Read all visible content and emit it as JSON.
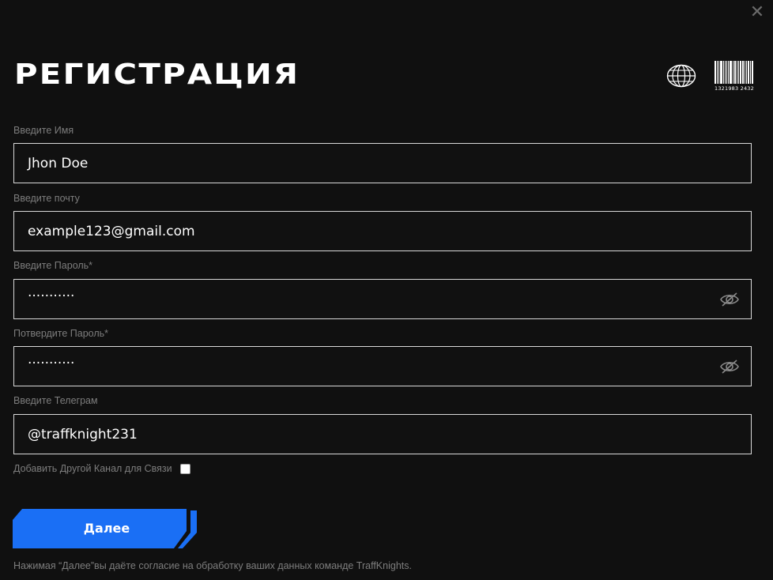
{
  "dialog": {
    "close_glyph": "✕",
    "title": "РЕГИСТРАЦИЯ",
    "barcode_number": "1321983 2432"
  },
  "form": {
    "name": {
      "label": "Введите Имя",
      "value": "Jhon Doe"
    },
    "email": {
      "label": "Введите почту",
      "value": "example123@gmail.com"
    },
    "password": {
      "label": "Введите Пароль*",
      "masked_value": "···········"
    },
    "password_confirm": {
      "label": "Потвердите Пароль*",
      "masked_value": "···········"
    },
    "telegram": {
      "label": "Введите Телеграм",
      "value": "@traffknight231"
    },
    "extra_channel": {
      "label": "Добавить Другой Канал для Связи",
      "checked": false
    }
  },
  "actions": {
    "next_label": "Далее"
  },
  "consent_text": "Нажимая “Далее”вы даёте согласие на обработку ваших данных команде TraffKnights.",
  "icons": {
    "close": "close-icon",
    "globe": "globe-icon",
    "barcode": "barcode-icon",
    "eye": "eye-off-icon"
  },
  "colors": {
    "background": "#101010",
    "accent": "#1a6ff5",
    "field_border": "#d9d9d9",
    "label": "#7d7d7d"
  }
}
